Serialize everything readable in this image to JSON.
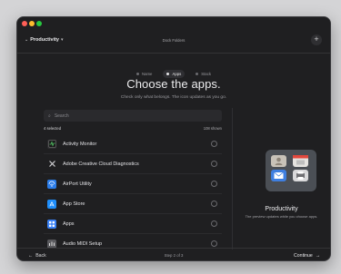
{
  "toolbar": {
    "workspace_label": "Productivity",
    "title": "Dock Folders",
    "add_label": "+"
  },
  "steps": [
    {
      "label": "Name",
      "active": false
    },
    {
      "label": "Apps",
      "active": true
    },
    {
      "label": "Stack",
      "active": false
    }
  ],
  "heading": "Choose the apps.",
  "subheading": "Check only what belongs. The icon updates as you go.",
  "search": {
    "placeholder": "Search",
    "value": ""
  },
  "meta": {
    "selected": "4 selected",
    "shown": "108 shown"
  },
  "apps": [
    {
      "name": "Activity Monitor",
      "icon": "activity-monitor-icon",
      "color": "#2d2d30",
      "selected": false
    },
    {
      "name": "Adobe Creative Cloud Diagnostics",
      "icon": "wrench-icon",
      "color": "#2d2d30",
      "selected": false
    },
    {
      "name": "AirPort Utility",
      "icon": "airport-icon",
      "color": "#2b7de9",
      "selected": false
    },
    {
      "name": "App Store",
      "icon": "app-store-icon",
      "color": "#1f8efa",
      "selected": false
    },
    {
      "name": "Apps",
      "icon": "apps-icon",
      "color": "#3b82f6",
      "selected": false
    },
    {
      "name": "Audio MIDI Setup",
      "icon": "audio-icon",
      "color": "#5a5a5e",
      "selected": false
    }
  ],
  "preview": {
    "title": "Productivity",
    "caption": "The preview updates while you choose apps.",
    "folder_colors": [
      "#c8c2b8",
      "#e4e2df",
      "#3f7fe0",
      "#d9d9db"
    ]
  },
  "footer": {
    "back_label": "Back",
    "step_label": "Step 2 of 3",
    "continue_label": "Continue"
  }
}
